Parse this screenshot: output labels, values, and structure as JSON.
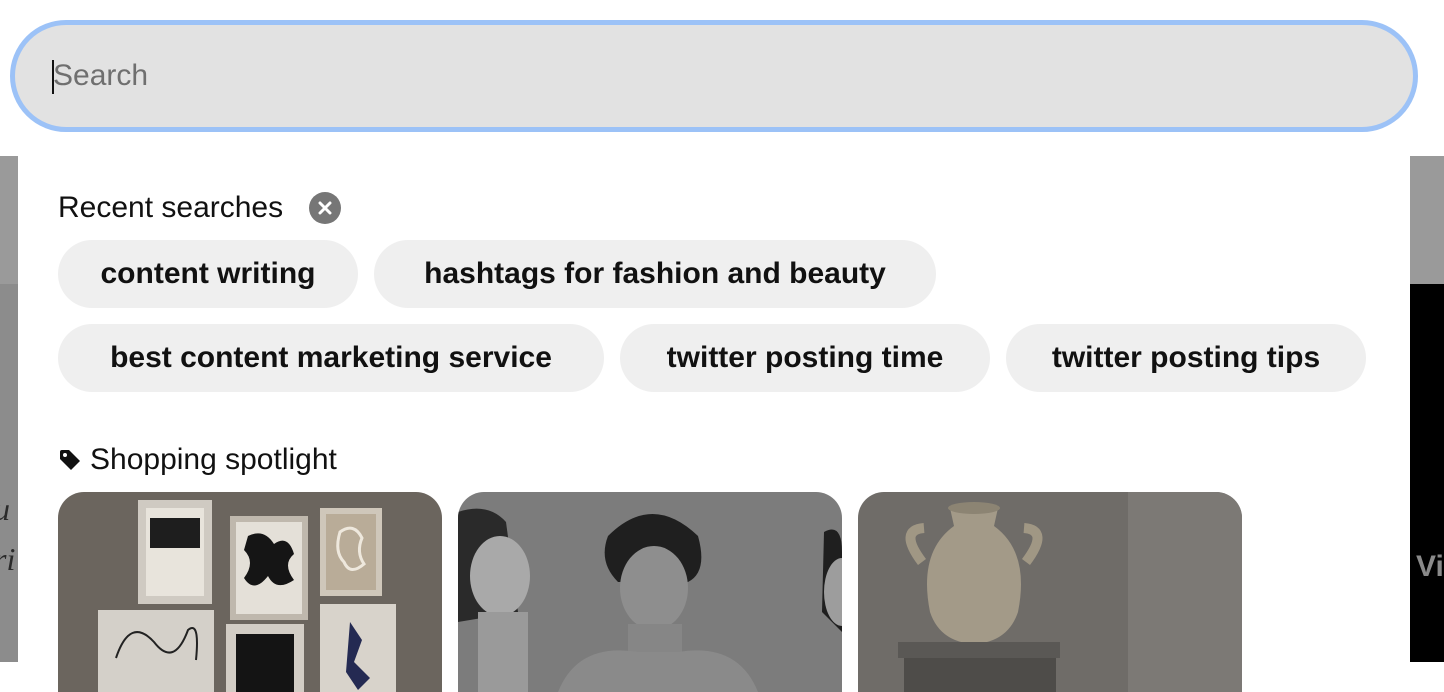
{
  "search": {
    "placeholder": "Search",
    "value": ""
  },
  "recent": {
    "title": "Recent searches",
    "chips": [
      "content writing",
      "hashtags for fashion and beauty",
      "best content marketing service",
      "twitter posting time",
      "twitter posting tips"
    ]
  },
  "shopping": {
    "title": "Shopping spotlight"
  },
  "icons": {
    "clear": "close-circle-icon",
    "tag": "tag-icon"
  },
  "colors": {
    "focus_ring": "#9cc2f7",
    "search_bg": "#e2e2e2",
    "chip_bg": "#efefef",
    "clear_button": "#767676"
  }
}
